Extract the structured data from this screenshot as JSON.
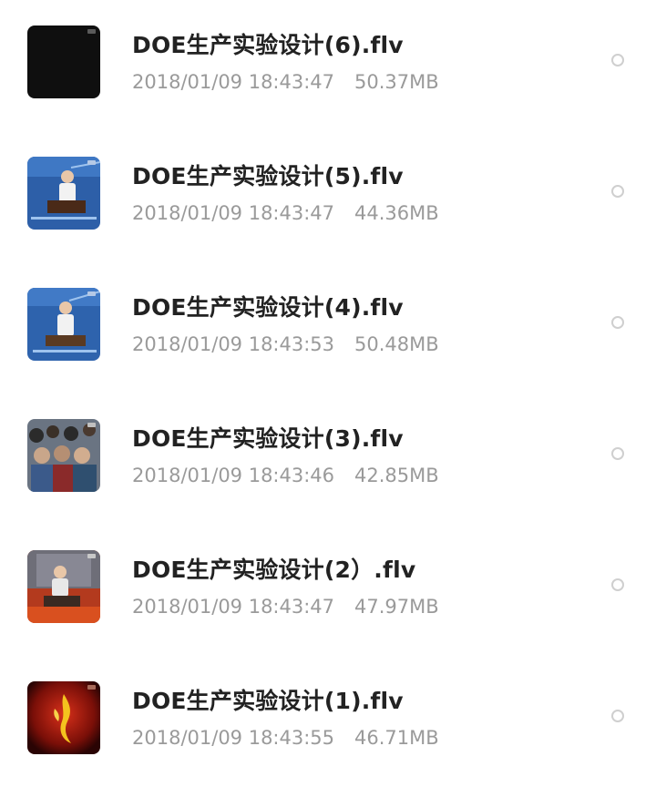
{
  "files": [
    {
      "name": "DOE生产实验设计(6).flv",
      "date": "2018/01/09 18:43:47",
      "size": "50.37MB",
      "thumbnail": "black-video-thumbnail"
    },
    {
      "name": "DOE生产实验设计(5).flv",
      "date": "2018/01/09 18:43:47",
      "size": "44.36MB",
      "thumbnail": "lecturer-at-podium-thumbnail"
    },
    {
      "name": "DOE生产实验设计(4).flv",
      "date": "2018/01/09 18:43:53",
      "size": "50.48MB",
      "thumbnail": "lecturer-at-podium-thumbnail"
    },
    {
      "name": "DOE生产实验设计(3).flv",
      "date": "2018/01/09 18:43:46",
      "size": "42.85MB",
      "thumbnail": "audience-crowd-thumbnail"
    },
    {
      "name": "DOE生产实验设计(2）.flv",
      "date": "2018/01/09 18:43:47",
      "size": "47.97MB",
      "thumbnail": "lecturer-red-stage-thumbnail"
    },
    {
      "name": "DOE生产实验设计(1).flv",
      "date": "2018/01/09 18:43:55",
      "size": "46.71MB",
      "thumbnail": "red-logo-thumbnail"
    }
  ],
  "colors": {
    "title_text": "#222222",
    "meta_text": "#9a9a9a",
    "radio_border": "#cfcfcf"
  }
}
